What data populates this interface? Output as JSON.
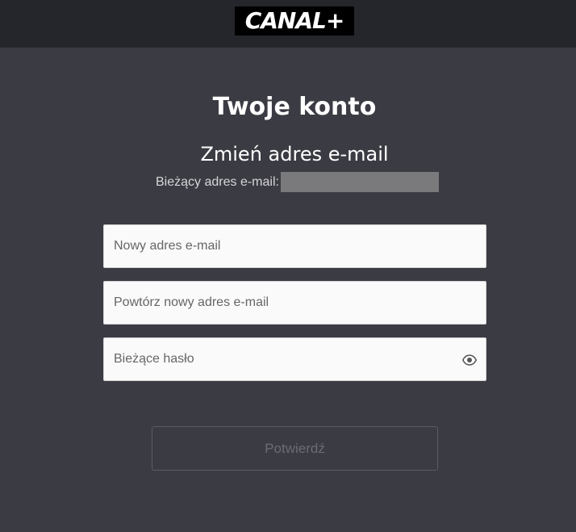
{
  "header": {
    "logo_text": "CANAL+"
  },
  "main": {
    "title": "Twoje konto",
    "section_title": "Zmień adres e-mail",
    "current_email_label": "Bieżący adres e-mail:"
  },
  "form": {
    "new_email_placeholder": "Nowy adres e-mail",
    "new_email_value": "",
    "repeat_email_placeholder": "Powtórz nowy adres e-mail",
    "repeat_email_value": "",
    "password_placeholder": "Bieżące hasło",
    "password_value": "",
    "password_toggle_icon": "eye-icon",
    "confirm_label": "Potwierdź"
  },
  "colors": {
    "page_background": "#3b3b43",
    "header_background": "#25262b",
    "field_background": "#fafafa",
    "button_border": "#5c5d64"
  }
}
